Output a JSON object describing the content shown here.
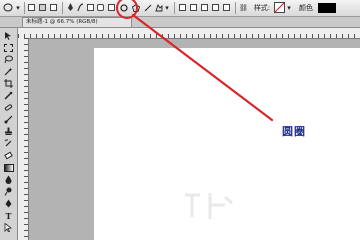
{
  "toolbar": {
    "style_label": "样式:",
    "color_label": "颜色"
  },
  "document_tab": {
    "title": "未标题-1 @ 66.7% (RGB/8)"
  },
  "annotation": {
    "text": "圆圈",
    "color": "#1f2f8a",
    "highlight_color": "#d8262c"
  }
}
